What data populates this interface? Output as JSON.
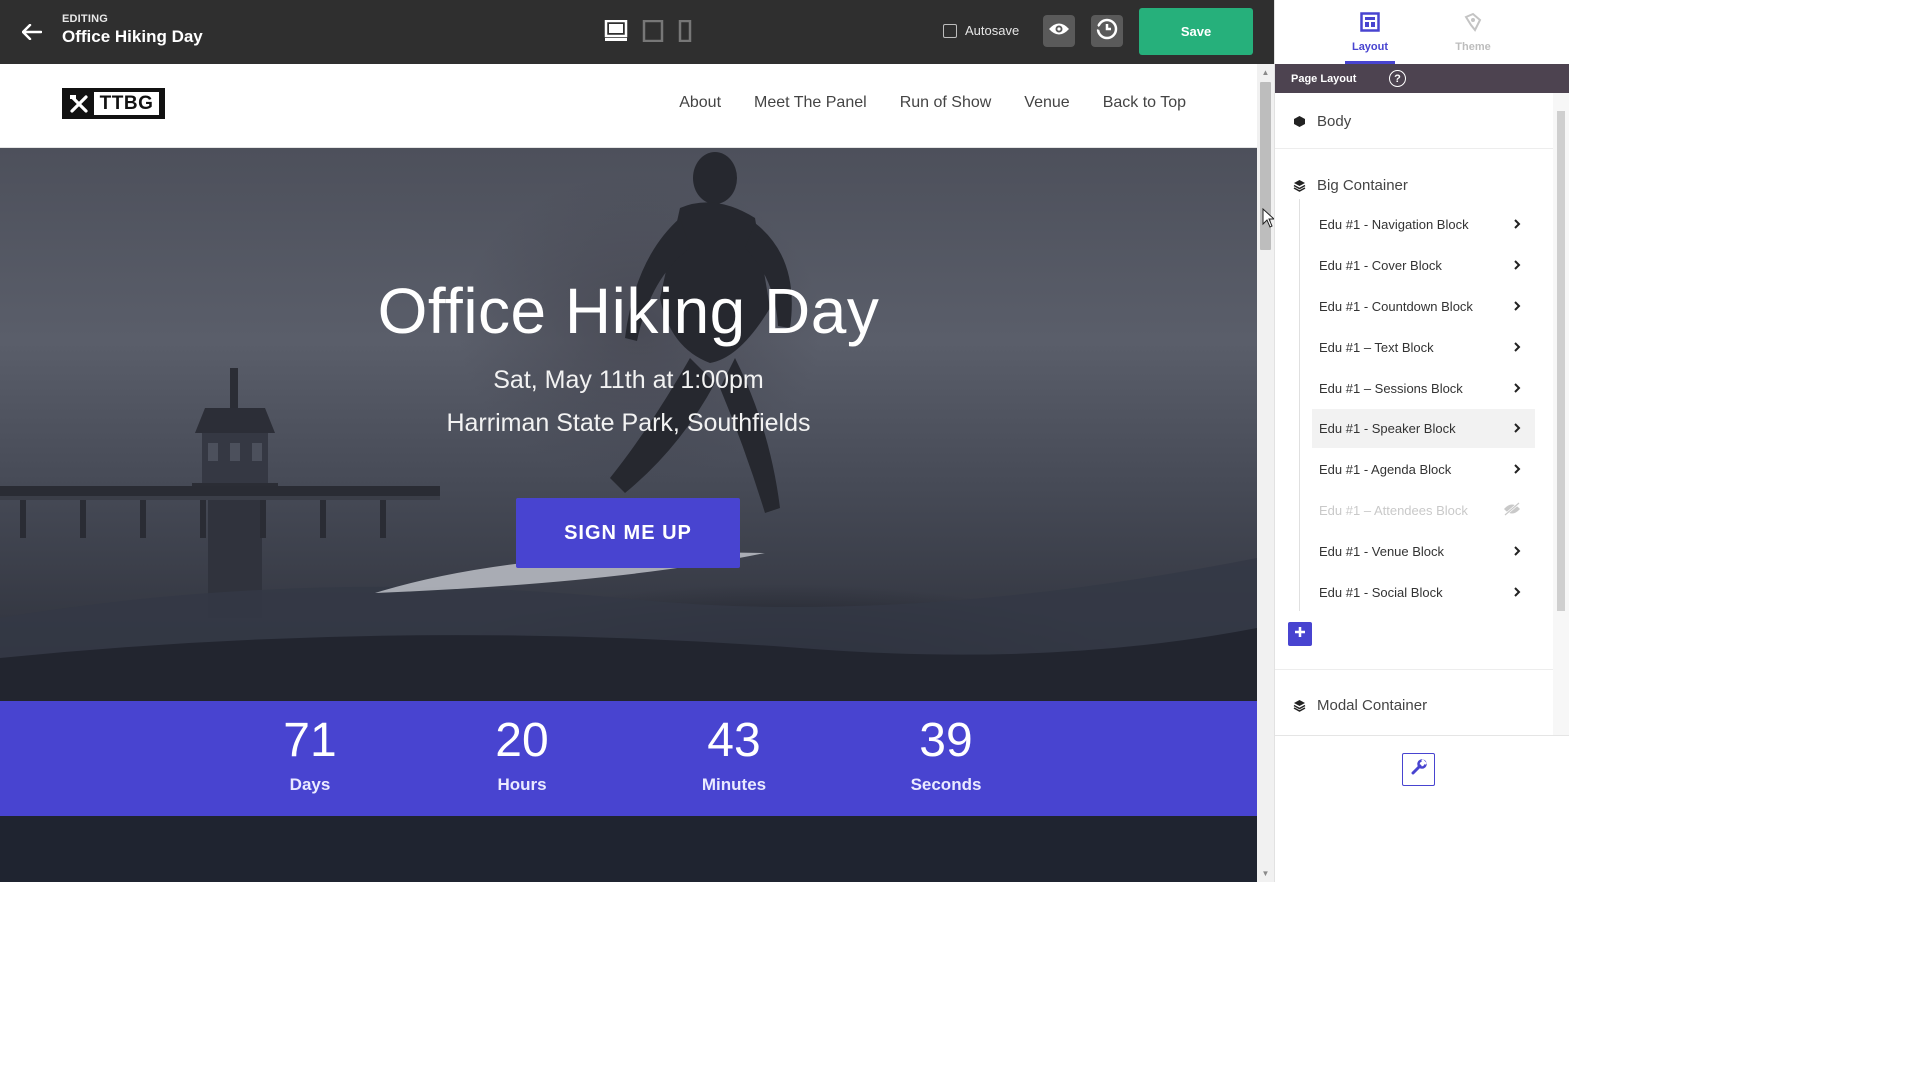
{
  "editor": {
    "editing_label": "EDITING",
    "page_title": "Office Hiking Day",
    "autosave_label": "Autosave",
    "save_label": "Save",
    "devices": [
      "desktop-icon",
      "tablet-icon",
      "mobile-icon"
    ]
  },
  "site": {
    "logo_text": "TTBG",
    "nav": [
      "About",
      "Meet The Panel",
      "Run of Show",
      "Venue",
      "Back to Top"
    ],
    "hero": {
      "title": "Office Hiking Day",
      "date": "Sat, May 11th at 1:00pm",
      "venue": "Harriman State Park, Southfields",
      "cta": "SIGN ME UP"
    },
    "countdown": [
      {
        "value": "71",
        "label": "Days"
      },
      {
        "value": "20",
        "label": "Hours"
      },
      {
        "value": "43",
        "label": "Minutes"
      },
      {
        "value": "39",
        "label": "Seconds"
      }
    ]
  },
  "panel": {
    "tabs": [
      {
        "label": "Layout",
        "active": true
      },
      {
        "label": "Theme",
        "active": false
      }
    ],
    "section_title": "Page Layout",
    "help": "?",
    "tree": {
      "body": "Body",
      "big_container": "Big Container",
      "children": [
        "Edu #1 - Navigation Block",
        "Edu #1 - Cover Block",
        "Edu #1 - Countdown Block",
        "Edu #1 – Text Block",
        "Edu #1 – Sessions Block",
        "Edu #1 - Speaker Block",
        "Edu #1 - Agenda Block",
        "Edu #1 – Attendees Block",
        "Edu #1 - Venue Block",
        "Edu #1 - Social Block"
      ],
      "hovered_index": 5,
      "hidden_index": 7,
      "modal_container": "Modal Container"
    }
  },
  "colors": {
    "accent": "#4844d0",
    "save_green": "#26b07b",
    "topbar": "#2f2f2f",
    "section_head": "#4d4350"
  }
}
